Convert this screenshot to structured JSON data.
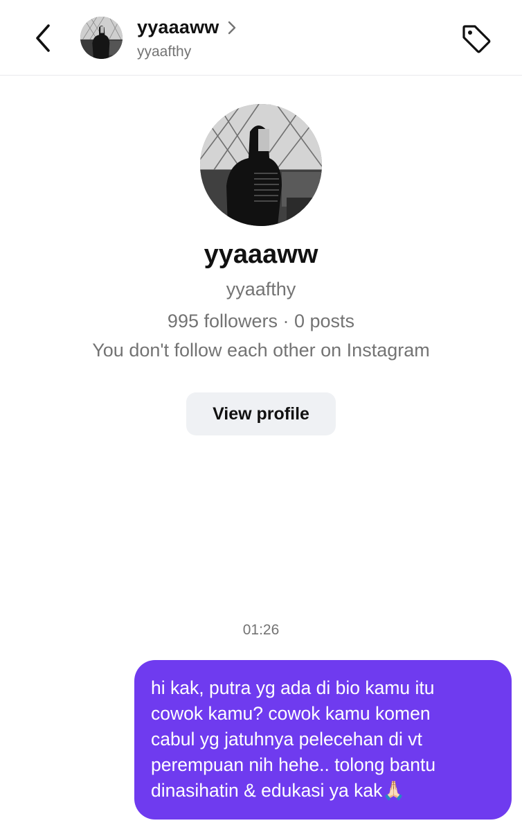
{
  "header": {
    "display_name": "yyaaaww",
    "username": "yyaafthy",
    "back_icon": "chevron-left-icon",
    "tag_icon": "tag-icon",
    "chevron_icon": "chevron-right-icon"
  },
  "profile": {
    "display_name": "yyaaaww",
    "username": "yyaafthy",
    "stats": "995 followers · 0 posts",
    "follow_status": "You don't follow each other on Instagram",
    "view_profile_label": "View profile"
  },
  "thread": {
    "timestamp": "01:26",
    "messages": [
      {
        "sender": "me",
        "text": "hi kak, putra yg ada di bio kamu itu\ncowok kamu? cowok kamu komen\ncabul yg jatuhnya pelecehan di vt\nperempuan nih hehe.. tolong bantu\ndinasihatin & edukasi ya kak🙏🏻",
        "bubble_color": "#6f3bef"
      }
    ]
  },
  "colors": {
    "accent": "#6f3bef",
    "secondary_text": "#737373",
    "button_bg": "#eff1f4"
  }
}
